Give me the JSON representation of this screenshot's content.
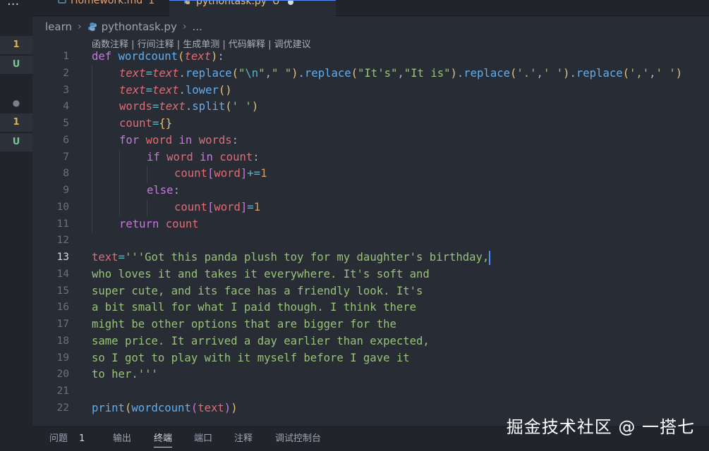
{
  "activity": {
    "badge_1": "1",
    "badge_u1": "U",
    "badge_2": "1",
    "badge_u2": "U"
  },
  "tabs": {
    "more": "...",
    "tab1_name": "Homework.md",
    "tab1_badge": "1",
    "tab2_name": "pythontask.py",
    "tab2_badge": "U"
  },
  "breadcrumb": {
    "folder": "learn",
    "file": "pythontask.py",
    "more": "..."
  },
  "codelens": "函数注释 | 行间注释 | 生成单测 | 代码解释 | 调优建议",
  "line_numbers": [
    "1",
    "2",
    "3",
    "4",
    "5",
    "6",
    "7",
    "8",
    "9",
    "10",
    "11",
    "12",
    "13",
    "14",
    "15",
    "16",
    "17",
    "18",
    "19",
    "20",
    "21",
    "22"
  ],
  "code": {
    "l1_def": "def",
    "l1_fn": "wordcount",
    "l1_param": "text",
    "l2_a": "text",
    "l2_b": "text",
    "l2_m": "replace",
    "l2_s1": "\"",
    "l2_esc": "\\n",
    "l2_s1b": "\"",
    "l2_s2": "\" \"",
    "l2_s3": "\"It's\"",
    "l2_s4": "\"It is\"",
    "l2_s5": "'.'",
    "l2_s6": "' '",
    "l2_s7": "','",
    "l2_s8": "' '",
    "l3_a": "text",
    "l3_b": "text",
    "l3_m": "lower",
    "l4_a": "words",
    "l4_b": "text",
    "l4_m": "split",
    "l4_s": "' '",
    "l5_a": "count",
    "l6_for": "for",
    "l6_v": "word",
    "l6_in": "in",
    "l6_it": "words",
    "l7_if": "if",
    "l7_v": "word",
    "l7_in": "in",
    "l7_c": "count",
    "l8_c": "count",
    "l8_k": "word",
    "l8_n": "1",
    "l9_else": "else",
    "l10_c": "count",
    "l10_k": "word",
    "l10_n": "1",
    "l11_ret": "return",
    "l11_v": "count",
    "l13_v": "text",
    "l13_s": "'''Got this panda plush toy for my daughter's birthday,",
    "l14_s": "who loves it and takes it everywhere. It's soft and",
    "l15_s": "super cute, and its face has a friendly look. It's",
    "l16_s": "a bit small for what I paid though. I think there",
    "l17_s": "might be other options that are bigger for the",
    "l18_s": "same price. It arrived a day earlier than expected,",
    "l19_s": "so I got to play with it myself before I gave it",
    "l20_s": "to her.'''",
    "l22_print": "print",
    "l22_fn": "wordcount",
    "l22_arg": "text"
  },
  "panel": {
    "problems": "问题",
    "problems_count": "1",
    "output": "输出",
    "terminal": "终端",
    "ports": "端口",
    "comments": "注释",
    "debug_console": "调试控制台"
  },
  "watermark": "掘金技术社区 @ 一搭七",
  "colors": {
    "editor_bg": "#282c34",
    "keyword": "#c678dd",
    "function": "#61afef",
    "variable": "#e06c75",
    "string": "#98c379",
    "number": "#d19a66"
  }
}
